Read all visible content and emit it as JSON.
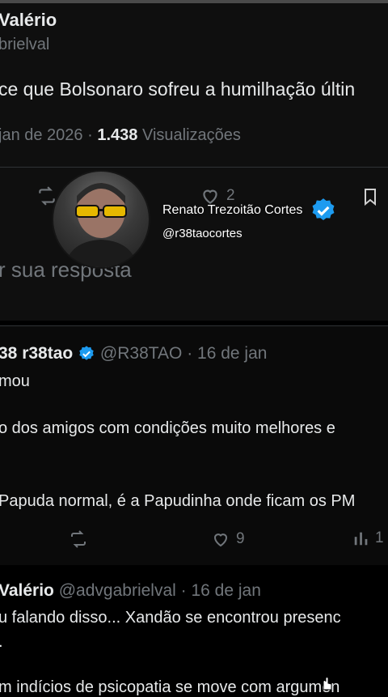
{
  "tweet_main": {
    "author_name": "Valério",
    "author_handle": "brielval",
    "text": "ce que Bolsonaro sofreu a humilhação últin",
    "date": "jan de 2026",
    "separator": "·",
    "views_count": "1.438",
    "views_label": "Visualizações",
    "likes": "2",
    "reply_placeholder": "r sua resposta"
  },
  "overlay": {
    "name": "Renato Trezoitão Cortes",
    "handle": "@r38taocortes"
  },
  "reply1": {
    "author_name": "38 r38tao",
    "author_handle": "@R38TAO",
    "date": "· 16 de jan",
    "line1": "mou",
    "line2": "o dos amigos com condições muito melhores e",
    "line3": "Papuda normal, é a Papudinha onde ficam os PM",
    "likes": "9",
    "views": "1"
  },
  "reply2": {
    "author_name": "Valério",
    "author_handle": "@advgabrielval",
    "date": "· 16 de jan",
    "line1": "u falando disso... Xandão se encontrou presenc",
    "line2": ".",
    "line3": "m indícios de psicopatia se move com argumen"
  },
  "colors": {
    "verified": "#1d9bf0",
    "muted": "#71767b",
    "text": "#e7e9ea"
  }
}
